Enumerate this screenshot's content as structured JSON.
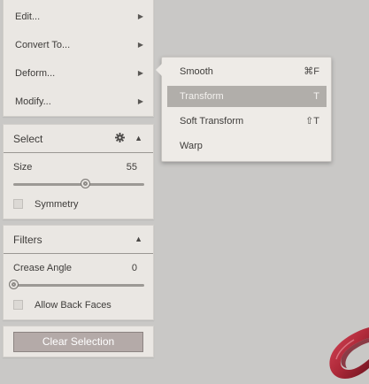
{
  "menu": {
    "items": [
      {
        "label": "Edit...",
        "arrow": "▶"
      },
      {
        "label": "Convert To...",
        "arrow": "▶"
      },
      {
        "label": "Deform...",
        "arrow": "▶"
      },
      {
        "label": "Modify...",
        "arrow": "▶"
      }
    ]
  },
  "submenu": {
    "items": [
      {
        "label": "Smooth",
        "shortcut": "⌘F"
      },
      {
        "label": "Transform",
        "shortcut": "T",
        "active": true
      },
      {
        "label": "Soft Transform",
        "shortcut": "⇧T"
      },
      {
        "label": "Warp",
        "shortcut": ""
      }
    ]
  },
  "select_panel": {
    "title": "Select",
    "gear_icon": "gear-icon",
    "collapse_icon": "▲",
    "size_label": "Size",
    "size_value": "55",
    "size_fraction": 0.55,
    "symmetry_label": "Symmetry",
    "symmetry_checked": false
  },
  "filters_panel": {
    "title": "Filters",
    "collapse_icon": "▲",
    "crease_label": "Crease Angle",
    "crease_value": "0",
    "crease_fraction": 0.0,
    "back_faces_label": "Allow Back Faces",
    "back_faces_checked": false
  },
  "clear": {
    "label": "Clear Selection"
  },
  "colors": {
    "background": "#c9c8c6",
    "panel": "#eae7e3",
    "active_item": "#b1aeaa",
    "button": "#b4aaa8",
    "object": "#b02a3a"
  }
}
